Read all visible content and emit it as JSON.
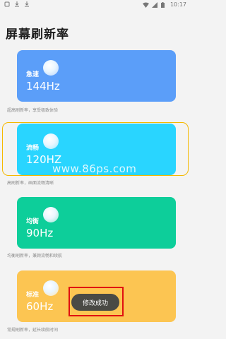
{
  "statusbar": {
    "time": "10:17",
    "left_icons": [
      "app-icon",
      "download-icon",
      "download-icon"
    ],
    "right_icons": [
      "wifi-icon",
      "signal-icon",
      "battery-icon"
    ]
  },
  "page": {
    "title": "屏幕刷新率"
  },
  "modes": [
    {
      "label": "急速",
      "hz": "144Hz",
      "description": "超高刷新率，享受极致体验",
      "color": "#5b9ef9"
    },
    {
      "label": "流畅",
      "hz": "120HZ",
      "description": "高刷新率，画面流畅清晰",
      "color": "#29d5ff"
    },
    {
      "label": "均衡",
      "hz": "90Hz",
      "description": "均衡刷新率，兼顾流畅和续航",
      "color": "#0dce9a"
    },
    {
      "label": "标准",
      "hz": "60Hz",
      "description": "常规刷新率，延长续航时间",
      "color": "#fcc552"
    }
  ],
  "selected_mode_index": 1,
  "watermark": {
    "text": "www.86ps.com"
  },
  "toast": {
    "text": "修改成功"
  }
}
